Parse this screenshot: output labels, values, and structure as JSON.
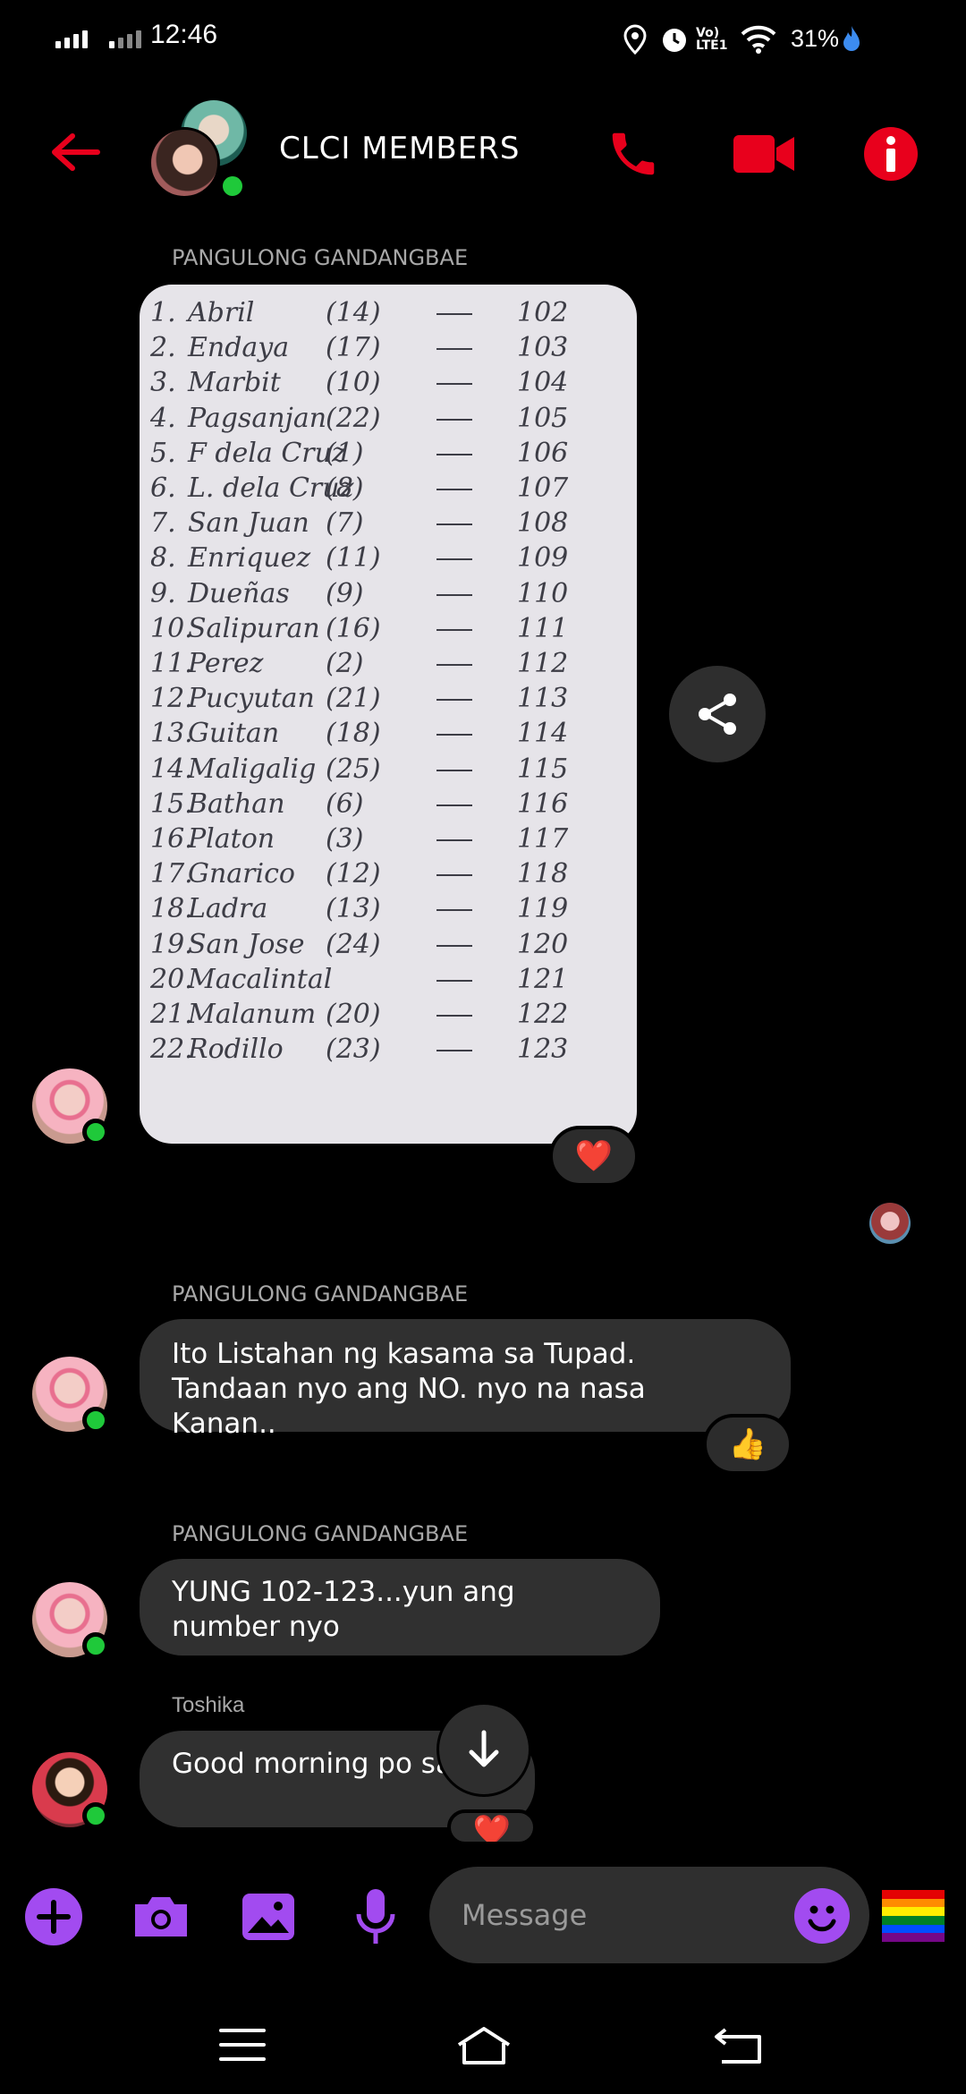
{
  "status_bar": {
    "time": "12:46",
    "battery": "31%",
    "network_label": "Vo) LTE1"
  },
  "header": {
    "title": "CLCI MEMBERS",
    "accent_color": "#e8001c"
  },
  "messages": [
    {
      "sender": "PANGULONG GANDANGBAE",
      "type": "photo",
      "ledger": [
        {
          "n": "1.",
          "name": "Abril",
          "num": "(14)",
          "no": "102"
        },
        {
          "n": "2.",
          "name": "Endaya",
          "num": "(17)",
          "no": "103"
        },
        {
          "n": "3.",
          "name": "Marbit",
          "num": "(10)",
          "no": "104"
        },
        {
          "n": "4.",
          "name": "Pagsanjan",
          "num": "(22)",
          "no": "105"
        },
        {
          "n": "5.",
          "name": "F dela Cruz",
          "num": "(1)",
          "no": "106"
        },
        {
          "n": "6.",
          "name": "L. dela Cruz",
          "num": "(8)",
          "no": "107"
        },
        {
          "n": "7.",
          "name": "San Juan",
          "num": "(7)",
          "no": "108"
        },
        {
          "n": "8.",
          "name": "Enriquez",
          "num": "(11)",
          "no": "109"
        },
        {
          "n": "9.",
          "name": "Dueñas",
          "num": "(9)",
          "no": "110"
        },
        {
          "n": "10.",
          "name": "Salipuran",
          "num": "(16)",
          "no": "111"
        },
        {
          "n": "11.",
          "name": "Perez",
          "num": "(2)",
          "no": "112"
        },
        {
          "n": "12.",
          "name": "Pucyutan",
          "num": "(21)",
          "no": "113"
        },
        {
          "n": "13.",
          "name": "Guitan",
          "num": "(18)",
          "no": "114"
        },
        {
          "n": "14.",
          "name": "Maligalig",
          "num": "(25)",
          "no": "115"
        },
        {
          "n": "15.",
          "name": "Bathan",
          "num": "(6)",
          "no": "116"
        },
        {
          "n": "16.",
          "name": "Platon",
          "num": "(3)",
          "no": "117"
        },
        {
          "n": "17.",
          "name": "Gnarico",
          "num": "(12)",
          "no": "118"
        },
        {
          "n": "18.",
          "name": "Ladra",
          "num": "(13)",
          "no": "119"
        },
        {
          "n": "19.",
          "name": "San Jose",
          "num": "(24)",
          "no": "120"
        },
        {
          "n": "20.",
          "name": "Macalintal",
          "num": "",
          "no": "121"
        },
        {
          "n": "21.",
          "name": "Malanum",
          "num": "(20)",
          "no": "122"
        },
        {
          "n": "22.",
          "name": "Rodillo",
          "num": "(23)",
          "no": "123"
        }
      ],
      "reaction": "❤️"
    },
    {
      "sender": "PANGULONG GANDANGBAE",
      "text": "Ito Listahan ng kasama sa Tupad. Tandaan nyo ang NO. nyo na nasa Kanan..",
      "reaction": "👍"
    },
    {
      "sender": "PANGULONG GANDANGBAE",
      "text": "YUNG 102-123...yun ang number nyo"
    },
    {
      "sender": "Toshika",
      "text": "Good morning po sa la",
      "reaction": "❤️"
    }
  ],
  "composer": {
    "placeholder": "Message",
    "accent_color": "#a24bf0"
  },
  "icons": {
    "back": "back-arrow-icon",
    "call": "phone-icon",
    "video": "video-camera-icon",
    "info": "info-icon",
    "share": "share-icon",
    "scroll": "arrow-down-icon"
  }
}
